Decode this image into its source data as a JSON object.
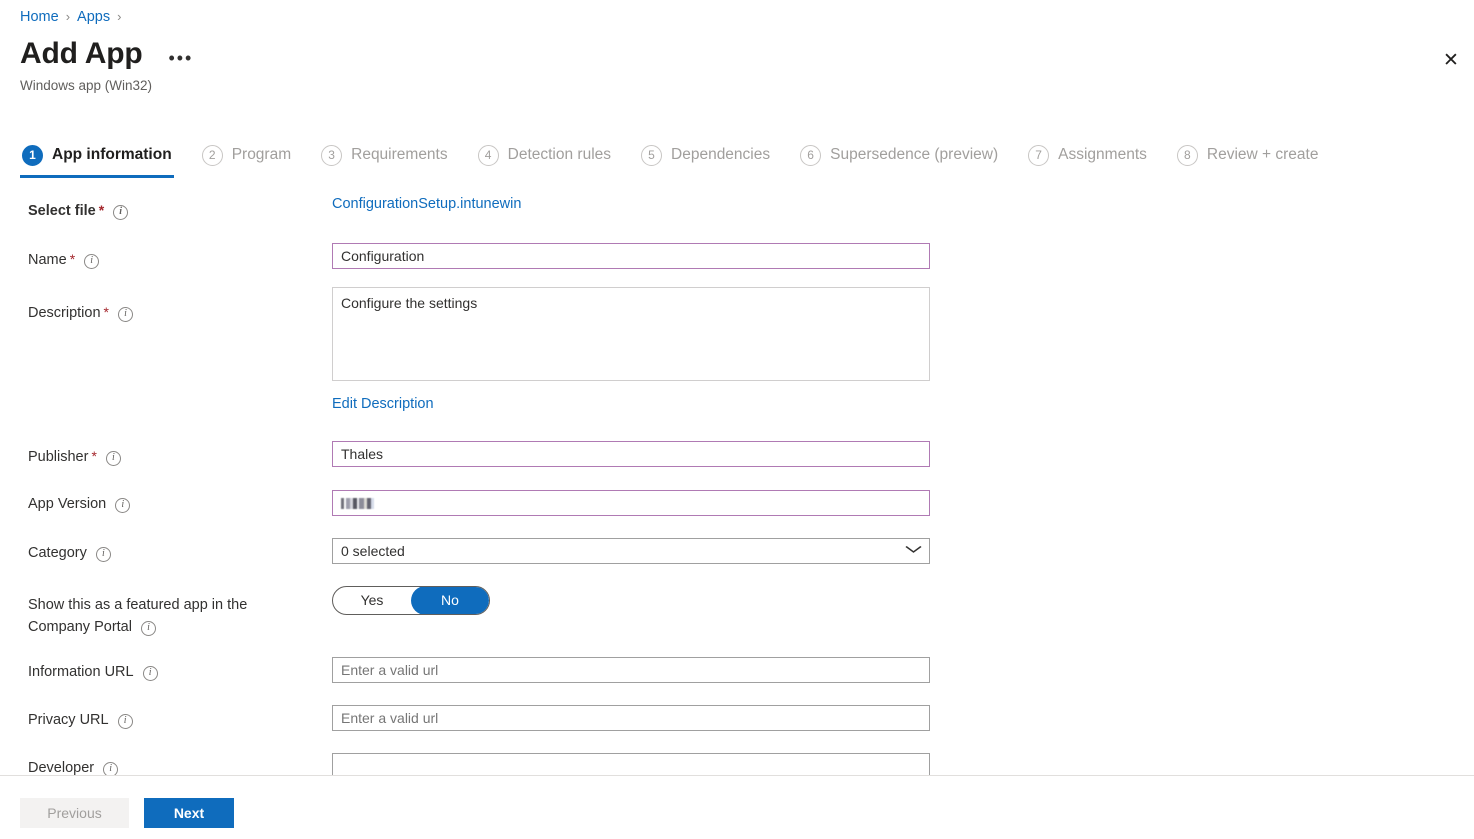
{
  "breadcrumb": {
    "items": [
      {
        "label": "Home"
      },
      {
        "label": "Apps"
      }
    ],
    "separator": "›"
  },
  "header": {
    "title": "Add App",
    "more_label": "•••",
    "subtitle": "Windows app (Win32)",
    "close_label": "✕"
  },
  "wizard": {
    "steps": [
      {
        "number": "1",
        "label": "App information",
        "active": true
      },
      {
        "number": "2",
        "label": "Program",
        "active": false
      },
      {
        "number": "3",
        "label": "Requirements",
        "active": false
      },
      {
        "number": "4",
        "label": "Detection rules",
        "active": false
      },
      {
        "number": "5",
        "label": "Dependencies",
        "active": false
      },
      {
        "number": "6",
        "label": "Supersedence (preview)",
        "active": false
      },
      {
        "number": "7",
        "label": "Assignments",
        "active": false
      },
      {
        "number": "8",
        "label": "Review + create",
        "active": false
      }
    ]
  },
  "form": {
    "info_icon_glyph": "i",
    "required_mark": "*",
    "select_file": {
      "label": "Select file",
      "file_name": "ConfigurationSetup.intunewin"
    },
    "name": {
      "label": "Name",
      "value": "Configuration"
    },
    "description": {
      "label": "Description",
      "value": "Configure the settings",
      "edit_link": "Edit Description"
    },
    "publisher": {
      "label": "Publisher",
      "value": "Thales"
    },
    "app_version": {
      "label": "App Version",
      "value": "",
      "redacted": true
    },
    "category": {
      "label": "Category",
      "value": "0 selected",
      "chevron": "⌄"
    },
    "featured": {
      "label_line1": "Show this as a featured app in the",
      "label_line2": "Company Portal",
      "options": [
        "Yes",
        "No"
      ],
      "selected": "No"
    },
    "information_url": {
      "label": "Information URL",
      "value": "",
      "placeholder": "Enter a valid url"
    },
    "privacy_url": {
      "label": "Privacy URL",
      "value": "",
      "placeholder": "Enter a valid url"
    },
    "developer": {
      "label": "Developer",
      "value": "",
      "placeholder": ""
    }
  },
  "footer": {
    "previous_label": "Previous",
    "next_label": "Next"
  },
  "colors": {
    "accent": "#0f6cbd",
    "link": "#0f6cbd",
    "required": "#a4262c",
    "filled_border": "#b07ab4",
    "field_border": "#a0a0a0",
    "muted_text": "#a19f9d"
  }
}
